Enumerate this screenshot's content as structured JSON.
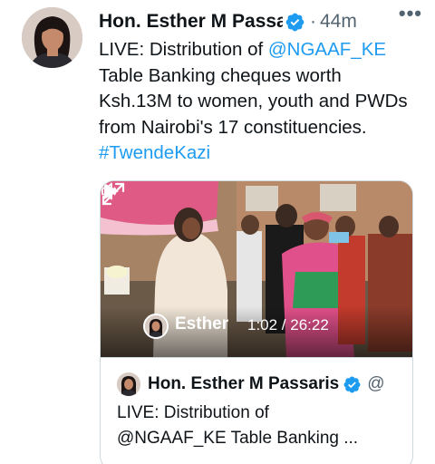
{
  "tweet": {
    "author_name": "Hon. Esther M Passaris",
    "separator": "·",
    "time": "44m",
    "more": "•••",
    "text_line1_prefix": "LIVE: Distribution of ",
    "mention": "@NGAAF_KE",
    "text_line2": "Table Banking cheques worth",
    "text_line3": "Ksh.13M to women, youth and PWDs",
    "text_line4": "from Nairobi's 17 constituencies.",
    "hashtag": "#TwendeKazi"
  },
  "video": {
    "channel_name": "Esther",
    "timecode": "1:02 / 26:22"
  },
  "quote": {
    "author_name": "Hon. Esther M Passaris",
    "handle": "@",
    "text_line1": "LIVE: Distribution of",
    "text_line2": "@NGAAF_KE Table Banking ..."
  },
  "colors": {
    "link": "#1d9bf0",
    "text": "#0f1419",
    "secondary": "#536471",
    "border": "#cfd9de",
    "verified": "#1d9bf0"
  },
  "icons": [
    "verified-badge-icon",
    "more-icon",
    "play-icon",
    "volume-icon",
    "fullscreen-icon"
  ]
}
